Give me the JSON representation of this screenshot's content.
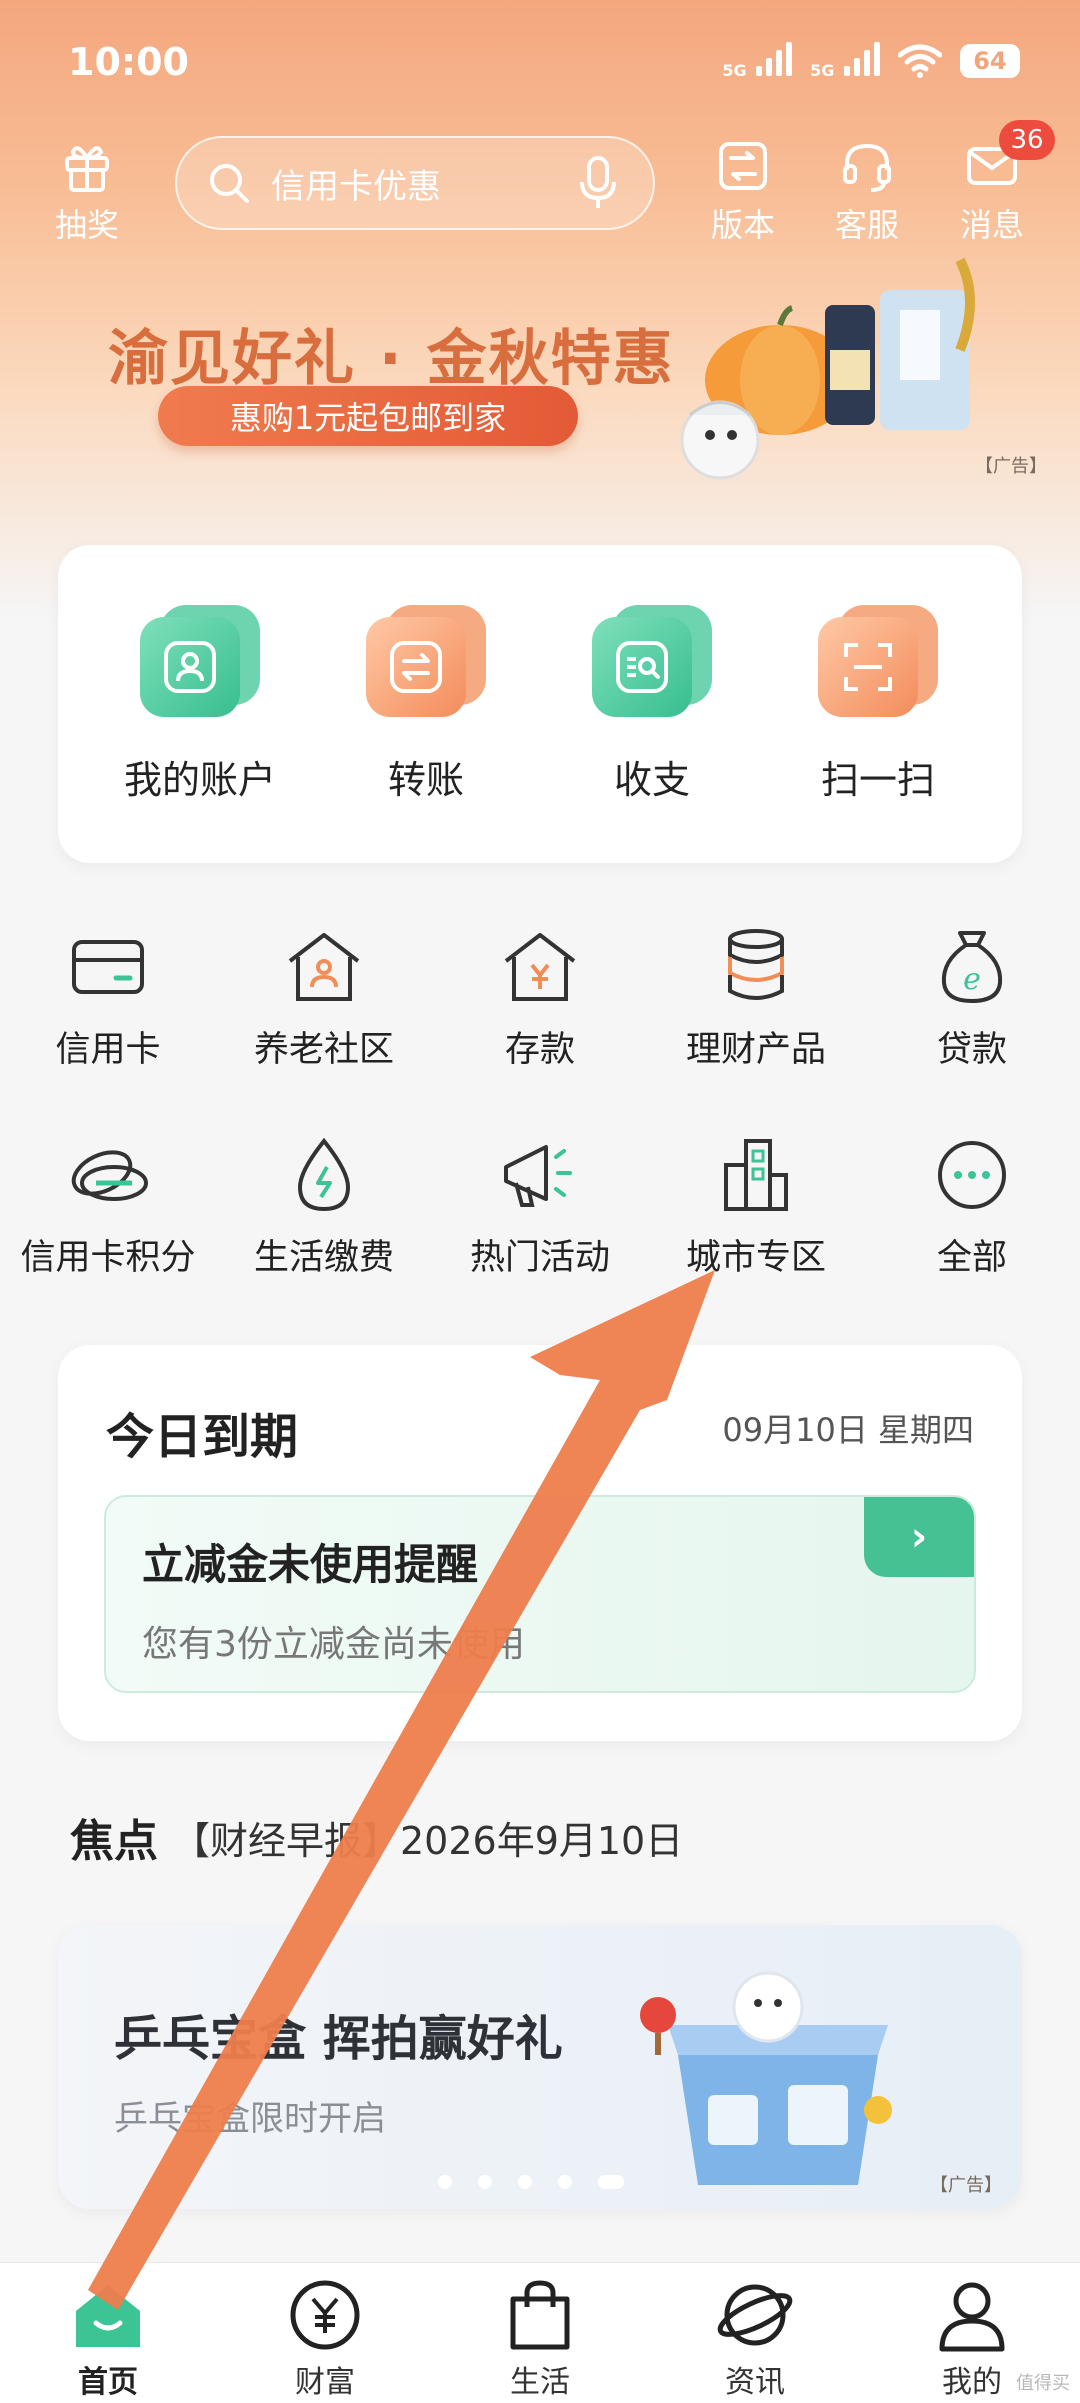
{
  "status_bar": {
    "time": "10:00",
    "network_1": "5G",
    "network_2": "5G",
    "battery": "64"
  },
  "header": {
    "lottery_label": "抽奖",
    "search_placeholder": "信用卡优惠",
    "version_label": "版本",
    "service_label": "客服",
    "messages_label": "消息",
    "messages_badge": "36"
  },
  "banner": {
    "title": "渝见好礼 · 金秋特惠",
    "subtitle": "惠购1元起包邮到家",
    "ad_tag": "【广告】"
  },
  "quick_actions": [
    {
      "label": "我的账户",
      "icon": "account-icon"
    },
    {
      "label": "转账",
      "icon": "transfer-icon"
    },
    {
      "label": "收支",
      "icon": "bill-search-icon"
    },
    {
      "label": "扫一扫",
      "icon": "scan-icon"
    }
  ],
  "services": [
    {
      "label": "信用卡",
      "icon": "credit-card-icon"
    },
    {
      "label": "养老社区",
      "icon": "pension-community-icon"
    },
    {
      "label": "存款",
      "icon": "deposit-icon"
    },
    {
      "label": "理财产品",
      "icon": "wealth-product-icon"
    },
    {
      "label": "贷款",
      "icon": "loan-icon"
    },
    {
      "label": "信用卡积分",
      "icon": "card-points-icon"
    },
    {
      "label": "生活缴费",
      "icon": "utility-payment-icon"
    },
    {
      "label": "热门活动",
      "icon": "megaphone-icon"
    },
    {
      "label": "城市专区",
      "icon": "city-zone-icon"
    },
    {
      "label": "全部",
      "icon": "more-icon"
    }
  ],
  "due_today": {
    "title": "今日到期",
    "date": "09月10日 星期四",
    "reminder_title": "立减金未使用提醒",
    "reminder_text": "您有3份立减金尚未使用"
  },
  "focus": {
    "tag": "焦点",
    "text": "【财经早报】2026年9月10日"
  },
  "promo": {
    "title": "乒乓宝盒 挥拍赢好礼",
    "subtitle": "乒乓宝盒限时开启",
    "ad_tag": "【广告】"
  },
  "tabbar": [
    {
      "label": "首页",
      "icon": "home-icon",
      "active": true
    },
    {
      "label": "财富",
      "icon": "wealth-icon"
    },
    {
      "label": "生活",
      "icon": "shopping-bag-icon"
    },
    {
      "label": "资讯",
      "icon": "planet-icon"
    },
    {
      "label": "我的",
      "icon": "profile-icon"
    }
  ],
  "watermark": "值得买",
  "colors": {
    "brand_green": "#3dc494",
    "accent_orange": "#f38d58",
    "annotation_arrow": "#ee7d4c",
    "badge_red": "#ee4b3f"
  }
}
